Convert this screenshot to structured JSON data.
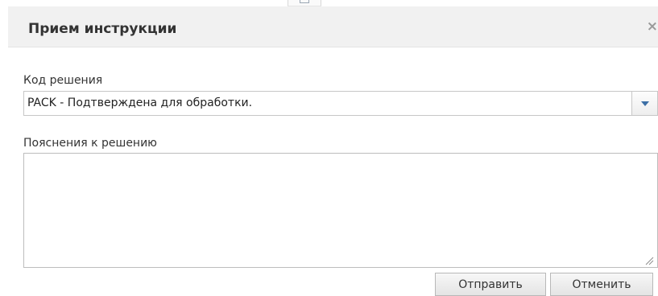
{
  "dialog": {
    "title": "Прием инструкции",
    "close_label": "×"
  },
  "form": {
    "decision_code_label": "Код решения",
    "decision_code_value": "PACK - Подтверждена для обработки.",
    "decision_notes_label": "Пояснения к решению",
    "decision_notes_value": ""
  },
  "buttons": {
    "send_label": "Отправить",
    "cancel_label": "Отменить"
  },
  "colors": {
    "header_background": "#f1f1f1",
    "dropdown_arrow": "#3c6fa6"
  },
  "icons": {
    "close": "close-icon",
    "dropdown": "chevron-down-icon",
    "resize": "resize-grip-icon"
  }
}
